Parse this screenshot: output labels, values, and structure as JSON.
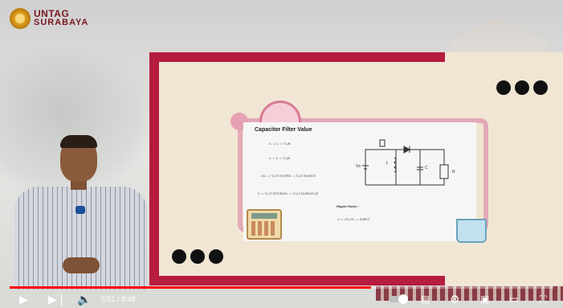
{
  "branding": {
    "line1": "UNTAG",
    "line2": "SURABAYA"
  },
  "slide": {
    "card_title": "Capacitor Filter Value",
    "formulas": [
      "I₂ = Iᵣ = Vₒ/R",
      "Iᵣ = Iₗ = Vₒ/R",
      "ΔVₒ = Vₒ(1-D)T/RC = Vₒ(1-D)/RCf",
      "C = Vₒ(1-D)T/RΔVₒ = Vₒ(1-D)/R(ΔVₒ)f"
    ],
    "ripple_title": "Ripple Factor :",
    "ripple_formula": "r = ΔVₒ/Vₒ = D/RCf",
    "circuit_labels": [
      "Vs",
      "L",
      "C",
      "R"
    ]
  },
  "player": {
    "progress": 0.664,
    "time_current": "5:51",
    "time_total": "8:48",
    "controls": [
      "play-icon",
      "next-icon",
      "volume-icon",
      "autoplay-toggle",
      "subtitles-icon",
      "settings-icon",
      "miniplayer-icon",
      "theater-icon",
      "fullscreen-icon"
    ],
    "accent": "#ff0000"
  },
  "colors": {
    "frame": "#b51c3d",
    "slide_bg": "#f1e6d3",
    "dots": "#111111"
  }
}
